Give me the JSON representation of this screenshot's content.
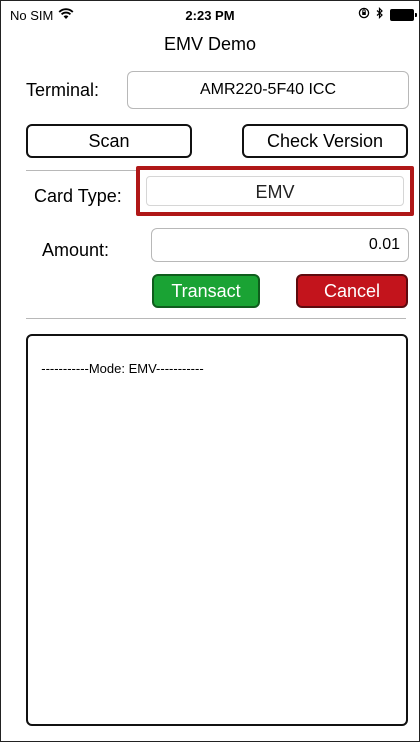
{
  "status_bar": {
    "carrier": "No SIM",
    "time": "2:23 PM",
    "wifi_icon": "wifi-icon",
    "lock_icon": "rotation-lock-icon",
    "bluetooth_icon": "bluetooth-icon",
    "battery_icon": "battery-icon"
  },
  "nav": {
    "title": "EMV Demo"
  },
  "terminal": {
    "label": "Terminal:",
    "value": "AMR220-5F40 ICC"
  },
  "buttons": {
    "scan": "Scan",
    "check_version": "Check Version",
    "transact": "Transact",
    "cancel": "Cancel"
  },
  "card_type": {
    "label": "Card Type:",
    "value": "EMV"
  },
  "amount": {
    "label": "Amount:",
    "value": "0.01"
  },
  "log": {
    "text": "-----------Mode: EMV-----------"
  },
  "colors": {
    "transact": "#1aa334",
    "cancel": "#c3141c",
    "highlight": "#b01818"
  }
}
